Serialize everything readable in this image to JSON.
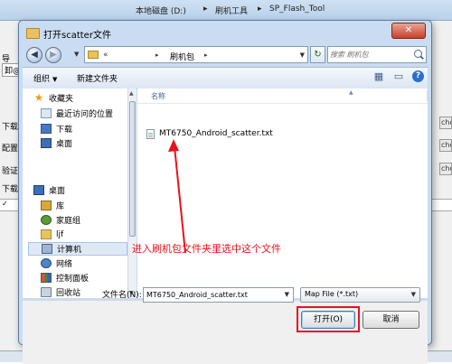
{
  "background_window": {
    "path_segments": [
      "本地磁盘 (D:)",
      "刷机工具",
      "SP_Flash_Tool"
    ],
    "side_labels": [
      "导",
      "卸@",
      "下载",
      "配置文",
      "验证文",
      "下载"
    ],
    "right_button_label": "cho",
    "list_row_left": "✓"
  },
  "dialog": {
    "title": "打开scatter文件",
    "close_label": "✕",
    "address": {
      "crumbs": [
        "«",
        "刷机包"
      ]
    },
    "search": {
      "placeholder": "搜索 刷机包"
    },
    "toolbar": {
      "organize": "组织",
      "new_folder": "新建文件夹"
    },
    "nav": {
      "favorites": "收藏夹",
      "recent": "最近访问的位置",
      "downloads": "下载",
      "desktop": "桌面",
      "desktop_root": "桌面",
      "libraries": "库",
      "homegroup": "家庭组",
      "user": "ljf",
      "computer": "计算机",
      "network": "网络",
      "control_panel": "控制面板",
      "recycle_bin": "回收站"
    },
    "file_list": {
      "column_name": "名称",
      "files": [
        "MT6750_Android_scatter.txt"
      ]
    },
    "annotation": "进入刷机包文件夹里选中这个文件",
    "filename_label": "文件名(N):",
    "filename_value": "MT6750_Android_scatter.txt",
    "filetype_value": "Map File (*.txt)",
    "open_button": "打开(O)",
    "cancel_button": "取消"
  },
  "colors": {
    "annotation_red": "#e8121c",
    "dialog_frame": "#c9dcf1"
  }
}
